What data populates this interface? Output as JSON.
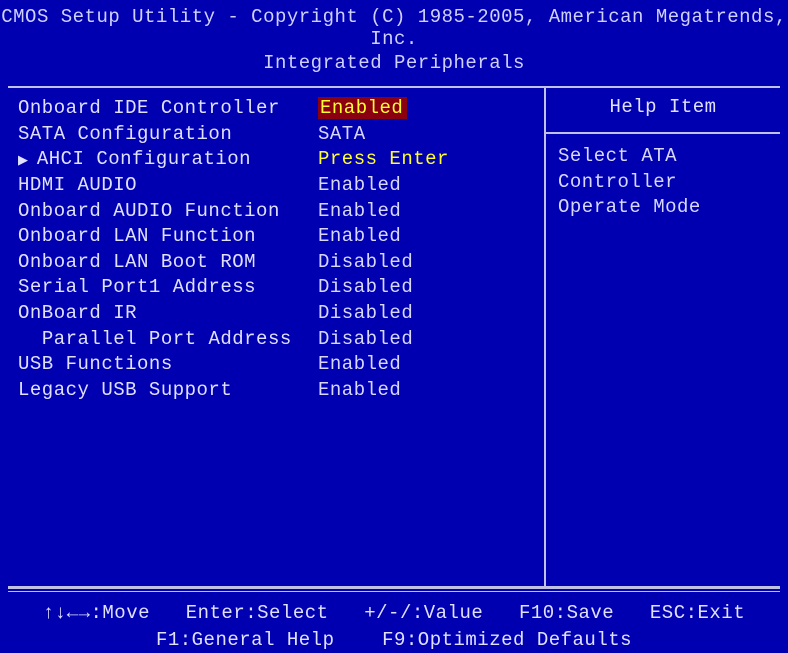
{
  "header": {
    "title_line1": "CMOS Setup Utility - Copyright (C) 1985-2005, American Megatrends, Inc.",
    "title_line2": "Integrated Peripherals"
  },
  "settings": [
    {
      "label": "Onboard IDE Controller",
      "value": "Enabled",
      "active": true
    },
    {
      "label": "SATA Configuration",
      "value": "SATA"
    },
    {
      "label": "AHCI Configuration",
      "value": "Press Enter",
      "submenu": true,
      "value_class": "val-enter"
    },
    {
      "label": "HDMI AUDIO",
      "value": "Enabled"
    },
    {
      "label": "Onboard AUDIO Function",
      "value": "Enabled"
    },
    {
      "label": "Onboard LAN Function",
      "value": "Enabled"
    },
    {
      "label": "Onboard LAN Boot ROM",
      "value": "Disabled"
    },
    {
      "label": "Serial Port1 Address",
      "value": "Disabled"
    },
    {
      "label": "OnBoard IR",
      "value": "Disabled"
    },
    {
      "label": "Parallel Port Address",
      "value": "Disabled",
      "indent": true
    },
    {
      "label": "USB Functions",
      "value": "Enabled"
    },
    {
      "label": "Legacy USB Support",
      "value": "Enabled"
    }
  ],
  "help": {
    "title": "Help Item",
    "body_line1": "Select ATA Controller",
    "body_line2": "Operate Mode"
  },
  "footer": {
    "line1": "↑↓←→:Move   Enter:Select   +/-/:Value   F10:Save   ESC:Exit",
    "line2": "F1:General Help    F9:Optimized Defaults"
  }
}
